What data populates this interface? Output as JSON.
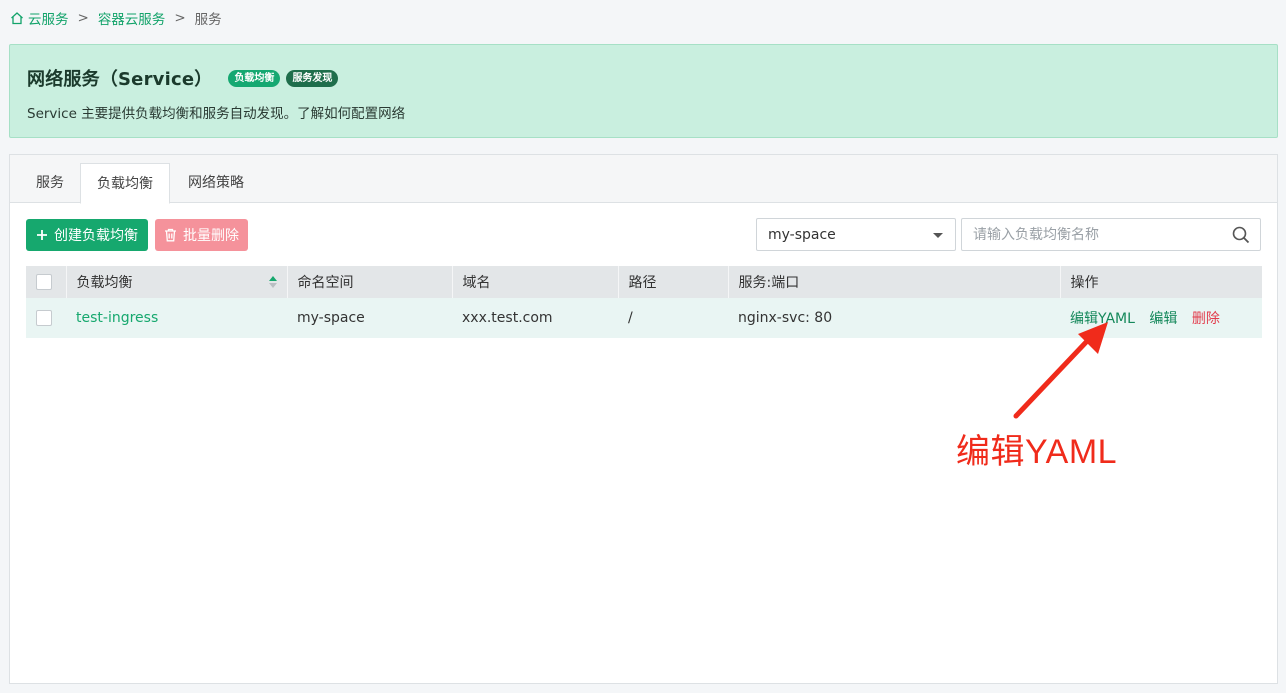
{
  "breadcrumb": {
    "items": [
      "云服务",
      "容器云服务",
      "服务"
    ],
    "separator": ">"
  },
  "banner": {
    "title": "网络服务（Service）",
    "badges": [
      "负载均衡",
      "服务发现"
    ],
    "description": "Service 主要提供负载均衡和服务自动发现。了解如何配置网络"
  },
  "tabs": [
    {
      "label": "服务",
      "active": false
    },
    {
      "label": "负载均衡",
      "active": true
    },
    {
      "label": "网络策略",
      "active": false
    }
  ],
  "toolbar": {
    "create_label": "创建负载均衡",
    "batch_delete_label": "批量删除",
    "namespace_value": "my-space",
    "search_placeholder": "请输入负载均衡名称"
  },
  "table": {
    "headers": [
      "负载均衡",
      "命名空间",
      "域名",
      "路径",
      "服务:端口",
      "操作"
    ],
    "rows": [
      {
        "name": "test-ingress",
        "namespace": "my-space",
        "domain": "xxx.test.com",
        "path": "/",
        "service_port": "nginx-svc: 80",
        "actions": {
          "edit_yaml": "编辑YAML",
          "edit": "编辑",
          "delete": "删除"
        }
      }
    ]
  },
  "annotation": {
    "text": "编辑YAML",
    "color": "#f02b1b"
  },
  "colors": {
    "accent": "#16a86e",
    "banner_bg": "#c9efdf",
    "danger": "#e23c4c"
  },
  "icons": [
    "home-icon",
    "plus-icon",
    "trash-icon",
    "chevron-down-icon",
    "search-icon",
    "sort-icon",
    "arrow-annotation"
  ]
}
